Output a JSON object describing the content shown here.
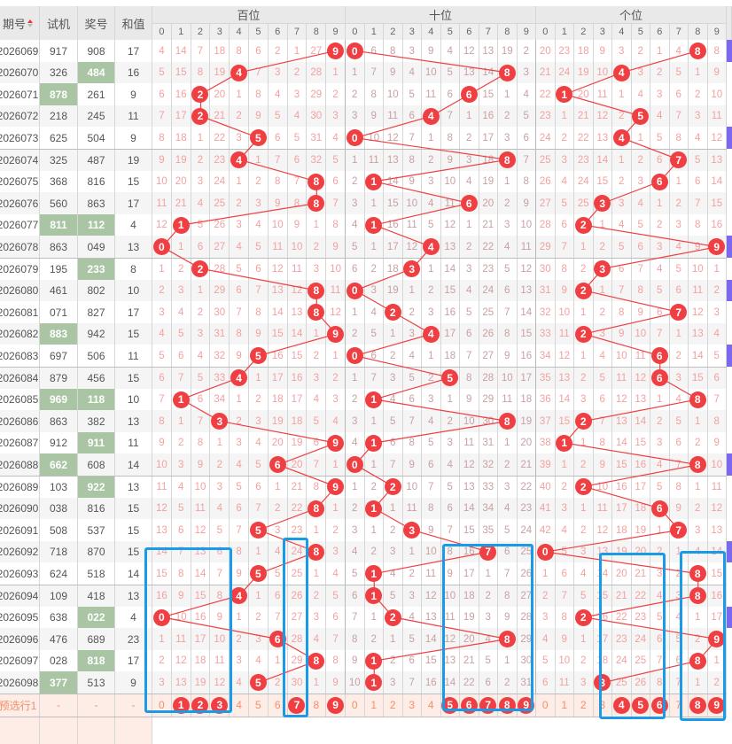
{
  "header": {
    "period": "期号",
    "test": "试机",
    "draw": "奖号",
    "sum": "和值",
    "groups": [
      "百位",
      "十位",
      "个位"
    ]
  },
  "digits": [
    "0",
    "1",
    "2",
    "3",
    "4",
    "5",
    "6",
    "7",
    "8",
    "9"
  ],
  "colors": {
    "ball": "#ef3f42",
    "pair": "#a9c5a3",
    "box": "#1a9be8",
    "mark": "#7b68ee"
  },
  "rows": [
    {
      "period": "2026069",
      "test": "917",
      "tp": false,
      "draw": "908",
      "dp": false,
      "sum": "17",
      "mark": true,
      "bai": [
        4,
        14,
        7,
        18,
        8,
        6,
        2,
        1,
        27,
        null
      ],
      "shi": [
        null,
        6,
        8,
        3,
        9,
        4,
        12,
        13,
        19,
        2
      ],
      "ge": [
        20,
        23,
        18,
        9,
        3,
        2,
        1,
        4,
        null,
        8
      ]
    },
    {
      "period": "2026070",
      "test": "326",
      "tp": false,
      "draw": "484",
      "dp": true,
      "sum": "16",
      "mark": false,
      "bai": [
        5,
        15,
        8,
        19,
        null,
        7,
        3,
        2,
        28,
        1
      ],
      "shi": [
        1,
        7,
        9,
        4,
        10,
        5,
        13,
        14,
        null,
        3
      ],
      "ge": [
        21,
        24,
        19,
        10,
        null,
        3,
        2,
        5,
        1,
        9
      ]
    },
    {
      "period": "2026071",
      "test": "878",
      "tp": true,
      "draw": "261",
      "dp": false,
      "sum": "9",
      "mark": false,
      "bai": [
        6,
        16,
        null,
        20,
        1,
        8,
        4,
        3,
        29,
        2
      ],
      "shi": [
        2,
        8,
        10,
        5,
        11,
        6,
        null,
        15,
        1,
        4
      ],
      "ge": [
        22,
        null,
        20,
        11,
        1,
        4,
        3,
        6,
        2,
        10
      ]
    },
    {
      "period": "2026072",
      "test": "218",
      "tp": false,
      "draw": "245",
      "dp": false,
      "sum": "11",
      "mark": false,
      "bai": [
        7,
        17,
        null,
        21,
        2,
        9,
        5,
        4,
        30,
        3
      ],
      "shi": [
        3,
        9,
        11,
        6,
        null,
        7,
        1,
        16,
        2,
        5
      ],
      "ge": [
        23,
        1,
        21,
        12,
        2,
        null,
        4,
        7,
        3,
        11
      ]
    },
    {
      "period": "2026073",
      "test": "625",
      "tp": false,
      "draw": "504",
      "dp": false,
      "sum": "9",
      "mark": true,
      "bai": [
        8,
        18,
        1,
        22,
        3,
        null,
        6,
        5,
        31,
        4
      ],
      "shi": [
        null,
        10,
        12,
        7,
        1,
        8,
        2,
        17,
        3,
        6
      ],
      "ge": [
        24,
        2,
        22,
        13,
        null,
        1,
        5,
        8,
        4,
        12
      ]
    },
    {
      "period": "2026074",
      "test": "325",
      "tp": false,
      "draw": "487",
      "dp": false,
      "sum": "19",
      "mark": false,
      "bai": [
        9,
        19,
        2,
        23,
        null,
        1,
        7,
        6,
        32,
        5
      ],
      "shi": [
        1,
        11,
        13,
        8,
        2,
        9,
        3,
        18,
        null,
        7
      ],
      "ge": [
        25,
        3,
        23,
        14,
        1,
        2,
        6,
        null,
        5,
        13
      ]
    },
    {
      "period": "2026075",
      "test": "368",
      "tp": false,
      "draw": "816",
      "dp": false,
      "sum": "15",
      "mark": false,
      "bai": [
        10,
        20,
        3,
        24,
        1,
        2,
        8,
        7,
        null,
        6
      ],
      "shi": [
        2,
        null,
        14,
        9,
        3,
        10,
        4,
        19,
        1,
        8
      ],
      "ge": [
        26,
        4,
        24,
        15,
        2,
        3,
        null,
        1,
        6,
        14
      ]
    },
    {
      "period": "2026076",
      "test": "560",
      "tp": false,
      "draw": "863",
      "dp": false,
      "sum": "17",
      "mark": false,
      "bai": [
        11,
        21,
        4,
        25,
        2,
        3,
        9,
        8,
        null,
        7
      ],
      "shi": [
        3,
        1,
        15,
        10,
        4,
        11,
        null,
        20,
        2,
        9
      ],
      "ge": [
        27,
        5,
        25,
        null,
        3,
        4,
        1,
        2,
        7,
        15
      ]
    },
    {
      "period": "2026077",
      "test": "811",
      "tp": true,
      "draw": "112",
      "dp": true,
      "sum": "4",
      "mark": false,
      "bai": [
        12,
        null,
        5,
        26,
        3,
        4,
        10,
        9,
        1,
        8
      ],
      "shi": [
        4,
        null,
        16,
        11,
        5,
        12,
        1,
        21,
        3,
        10
      ],
      "ge": [
        28,
        6,
        null,
        1,
        4,
        5,
        2,
        3,
        8,
        16
      ]
    },
    {
      "period": "2026078",
      "test": "863",
      "tp": false,
      "draw": "049",
      "dp": false,
      "sum": "13",
      "mark": true,
      "bai": [
        null,
        1,
        6,
        27,
        4,
        5,
        11,
        10,
        2,
        9
      ],
      "shi": [
        5,
        1,
        17,
        12,
        null,
        13,
        2,
        22,
        4,
        11
      ],
      "ge": [
        29,
        7,
        1,
        2,
        5,
        6,
        3,
        4,
        9,
        null
      ]
    },
    {
      "period": "2026079",
      "test": "195",
      "tp": false,
      "draw": "233",
      "dp": true,
      "sum": "8",
      "mark": false,
      "bai": [
        1,
        2,
        null,
        28,
        5,
        6,
        12,
        11,
        3,
        10
      ],
      "shi": [
        6,
        2,
        18,
        null,
        1,
        14,
        3,
        23,
        5,
        12
      ],
      "ge": [
        30,
        8,
        2,
        null,
        6,
        7,
        4,
        5,
        10,
        1
      ]
    },
    {
      "period": "2026080",
      "test": "461",
      "tp": false,
      "draw": "802",
      "dp": false,
      "sum": "10",
      "mark": true,
      "bai": [
        2,
        3,
        1,
        29,
        6,
        7,
        13,
        12,
        null,
        11
      ],
      "shi": [
        null,
        3,
        19,
        1,
        2,
        15,
        4,
        24,
        6,
        13
      ],
      "ge": [
        31,
        9,
        null,
        1,
        7,
        8,
        5,
        6,
        11,
        2
      ]
    },
    {
      "period": "2026081",
      "test": "071",
      "tp": false,
      "draw": "827",
      "dp": false,
      "sum": "17",
      "mark": false,
      "bai": [
        3,
        4,
        2,
        30,
        7,
        8,
        14,
        13,
        null,
        12
      ],
      "shi": [
        1,
        4,
        null,
        2,
        3,
        16,
        5,
        25,
        7,
        14
      ],
      "ge": [
        32,
        10,
        1,
        2,
        8,
        9,
        6,
        null,
        12,
        3
      ]
    },
    {
      "period": "2026082",
      "test": "883",
      "tp": true,
      "draw": "942",
      "dp": false,
      "sum": "15",
      "mark": false,
      "bai": [
        4,
        5,
        3,
        31,
        8,
        9,
        15,
        14,
        1,
        null
      ],
      "shi": [
        2,
        5,
        1,
        3,
        null,
        17,
        6,
        26,
        8,
        15
      ],
      "ge": [
        33,
        11,
        null,
        3,
        9,
        10,
        7,
        1,
        13,
        4
      ]
    },
    {
      "period": "2026083",
      "test": "697",
      "tp": false,
      "draw": "506",
      "dp": false,
      "sum": "11",
      "mark": true,
      "bai": [
        5,
        6,
        4,
        32,
        9,
        null,
        16,
        15,
        2,
        1
      ],
      "shi": [
        null,
        6,
        2,
        4,
        1,
        18,
        7,
        27,
        9,
        16
      ],
      "ge": [
        34,
        12,
        1,
        4,
        10,
        11,
        null,
        2,
        14,
        5
      ]
    },
    {
      "period": "2026084",
      "test": "879",
      "tp": false,
      "draw": "456",
      "dp": false,
      "sum": "15",
      "mark": false,
      "bai": [
        6,
        7,
        5,
        33,
        null,
        1,
        17,
        16,
        3,
        2
      ],
      "shi": [
        1,
        7,
        3,
        5,
        2,
        null,
        8,
        28,
        10,
        17
      ],
      "ge": [
        35,
        13,
        2,
        5,
        11,
        12,
        null,
        3,
        15,
        6
      ]
    },
    {
      "period": "2026085",
      "test": "969",
      "tp": true,
      "draw": "118",
      "dp": true,
      "sum": "10",
      "mark": false,
      "bai": [
        7,
        null,
        6,
        34,
        1,
        2,
        18,
        17,
        4,
        3
      ],
      "shi": [
        2,
        null,
        4,
        6,
        3,
        1,
        9,
        29,
        11,
        18
      ],
      "ge": [
        36,
        14,
        3,
        6,
        12,
        13,
        1,
        4,
        null,
        7
      ]
    },
    {
      "period": "2026086",
      "test": "863",
      "tp": false,
      "draw": "382",
      "dp": false,
      "sum": "13",
      "mark": false,
      "bai": [
        8,
        1,
        7,
        null,
        2,
        3,
        19,
        18,
        5,
        4
      ],
      "shi": [
        3,
        1,
        5,
        7,
        4,
        2,
        10,
        30,
        null,
        19
      ],
      "ge": [
        37,
        15,
        null,
        7,
        13,
        14,
        2,
        5,
        1,
        8
      ]
    },
    {
      "period": "2026087",
      "test": "912",
      "tp": false,
      "draw": "911",
      "dp": true,
      "sum": "11",
      "mark": false,
      "bai": [
        9,
        2,
        8,
        1,
        3,
        4,
        20,
        19,
        6,
        null
      ],
      "shi": [
        4,
        null,
        6,
        8,
        5,
        3,
        11,
        31,
        1,
        20
      ],
      "ge": [
        38,
        null,
        1,
        8,
        14,
        15,
        3,
        6,
        2,
        9
      ]
    },
    {
      "period": "2026088",
      "test": "662",
      "tp": true,
      "draw": "608",
      "dp": false,
      "sum": "14",
      "mark": true,
      "bai": [
        10,
        3,
        9,
        2,
        4,
        5,
        null,
        20,
        7,
        1
      ],
      "shi": [
        null,
        1,
        7,
        9,
        6,
        4,
        12,
        32,
        2,
        21
      ],
      "ge": [
        39,
        1,
        2,
        9,
        15,
        16,
        4,
        7,
        null,
        10
      ]
    },
    {
      "period": "2026089",
      "test": "103",
      "tp": false,
      "draw": "922",
      "dp": true,
      "sum": "13",
      "mark": false,
      "bai": [
        11,
        4,
        10,
        3,
        5,
        6,
        1,
        21,
        8,
        null
      ],
      "shi": [
        1,
        2,
        null,
        10,
        7,
        5,
        13,
        33,
        3,
        22
      ],
      "ge": [
        40,
        2,
        null,
        10,
        16,
        17,
        5,
        8,
        1,
        11
      ]
    },
    {
      "period": "2026090",
      "test": "038",
      "tp": false,
      "draw": "816",
      "dp": false,
      "sum": "15",
      "mark": false,
      "bai": [
        12,
        5,
        11,
        4,
        6,
        7,
        2,
        22,
        null,
        1
      ],
      "shi": [
        2,
        null,
        1,
        11,
        8,
        6,
        14,
        34,
        4,
        23
      ],
      "ge": [
        41,
        3,
        1,
        11,
        17,
        18,
        null,
        9,
        2,
        12
      ]
    },
    {
      "period": "2026091",
      "test": "508",
      "tp": false,
      "draw": "537",
      "dp": false,
      "sum": "15",
      "mark": false,
      "bai": [
        13,
        6,
        12,
        5,
        7,
        null,
        3,
        23,
        1,
        2
      ],
      "shi": [
        3,
        1,
        2,
        null,
        9,
        7,
        15,
        35,
        5,
        24
      ],
      "ge": [
        42,
        4,
        2,
        12,
        18,
        19,
        1,
        null,
        3,
        13
      ]
    },
    {
      "period": "2026092",
      "test": "718",
      "tp": false,
      "draw": "870",
      "dp": false,
      "sum": "15",
      "mark": true,
      "bai": [
        14,
        7,
        13,
        6,
        8,
        1,
        4,
        24,
        null,
        3
      ],
      "shi": [
        4,
        2,
        3,
        1,
        10,
        8,
        16,
        null,
        6,
        25
      ],
      "ge": [
        null,
        5,
        3,
        13,
        19,
        20,
        2,
        1,
        4,
        14
      ]
    },
    {
      "period": "2026093",
      "test": "624",
      "tp": false,
      "draw": "518",
      "dp": false,
      "sum": "14",
      "mark": false,
      "bai": [
        15,
        8,
        14,
        7,
        9,
        null,
        5,
        25,
        1,
        4
      ],
      "shi": [
        5,
        null,
        4,
        2,
        11,
        9,
        17,
        1,
        7,
        26
      ],
      "ge": [
        1,
        6,
        4,
        14,
        20,
        21,
        3,
        2,
        null,
        15
      ]
    },
    {
      "period": "2026094",
      "test": "109",
      "tp": false,
      "draw": "418",
      "dp": false,
      "sum": "13",
      "mark": false,
      "bai": [
        16,
        9,
        15,
        8,
        null,
        1,
        6,
        26,
        2,
        5
      ],
      "shi": [
        6,
        null,
        5,
        3,
        12,
        10,
        18,
        2,
        8,
        27
      ],
      "ge": [
        2,
        7,
        5,
        15,
        21,
        22,
        4,
        3,
        null,
        16
      ]
    },
    {
      "period": "2026095",
      "test": "638",
      "tp": false,
      "draw": "022",
      "dp": true,
      "sum": "4",
      "mark": true,
      "bai": [
        null,
        10,
        16,
        9,
        1,
        2,
        7,
        27,
        3,
        6
      ],
      "shi": [
        7,
        1,
        null,
        4,
        13,
        11,
        19,
        3,
        9,
        28
      ],
      "ge": [
        3,
        8,
        null,
        16,
        22,
        23,
        5,
        4,
        1,
        17
      ]
    },
    {
      "period": "2026096",
      "test": "476",
      "tp": false,
      "draw": "689",
      "dp": false,
      "sum": "23",
      "mark": false,
      "bai": [
        1,
        11,
        17,
        10,
        2,
        3,
        null,
        28,
        4,
        7
      ],
      "shi": [
        8,
        2,
        1,
        5,
        14,
        12,
        20,
        4,
        null,
        29
      ],
      "ge": [
        4,
        9,
        1,
        17,
        23,
        24,
        6,
        5,
        2,
        null
      ]
    },
    {
      "period": "2026097",
      "test": "028",
      "tp": false,
      "draw": "818",
      "dp": true,
      "sum": "17",
      "mark": false,
      "bai": [
        2,
        12,
        18,
        11,
        3,
        4,
        1,
        29,
        null,
        8
      ],
      "shi": [
        9,
        null,
        2,
        6,
        15,
        13,
        21,
        5,
        1,
        30
      ],
      "ge": [
        5,
        10,
        2,
        18,
        24,
        25,
        7,
        6,
        null,
        1
      ]
    },
    {
      "period": "2026098",
      "test": "377",
      "tp": true,
      "draw": "513",
      "dp": false,
      "sum": "9",
      "mark": false,
      "bai": [
        3,
        13,
        19,
        12,
        4,
        null,
        2,
        30,
        1,
        9
      ],
      "shi": [
        10,
        null,
        3,
        7,
        16,
        14,
        22,
        6,
        2,
        31
      ],
      "ge": [
        6,
        11,
        3,
        null,
        25,
        26,
        8,
        7,
        1,
        2
      ]
    }
  ],
  "preselect": {
    "label": "预选行1",
    "dash": "-",
    "bai": [
      false,
      true,
      true,
      true,
      false,
      false,
      false,
      true,
      false,
      true
    ],
    "shi": [
      false,
      false,
      false,
      false,
      false,
      true,
      true,
      true,
      true,
      true
    ],
    "ge": [
      false,
      false,
      false,
      false,
      true,
      true,
      true,
      false,
      true,
      true
    ]
  }
}
